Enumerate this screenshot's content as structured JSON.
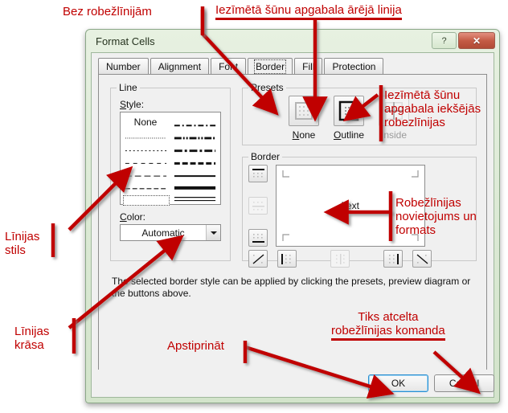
{
  "window": {
    "title": "Format Cells",
    "help_button": "?",
    "close_button": "✕"
  },
  "tabs": [
    {
      "label": "Number",
      "active": false
    },
    {
      "label": "Alignment",
      "active": false
    },
    {
      "label": "Font",
      "active": false
    },
    {
      "label": "Border",
      "active": true
    },
    {
      "label": "Fill",
      "active": false
    },
    {
      "label": "Protection",
      "active": false
    }
  ],
  "line_group": {
    "legend": "Line",
    "style_label": "Style:",
    "none_label": "None",
    "color_label": "Color:",
    "color_value": "Automatic",
    "styles_left": [
      "none",
      "dotted-fine",
      "dotted",
      "dashed-wide",
      "dash-long",
      "dashed-med",
      "hairline-selected"
    ],
    "styles_right": [
      "dash-dot-large",
      "dash-dot-dot-bold",
      "dash-dot-bold",
      "dash-med-bold",
      "solid-thin",
      "solid-thick",
      "double"
    ]
  },
  "presets_group": {
    "legend": "Presets",
    "items": [
      {
        "caption": "None",
        "enabled": true
      },
      {
        "caption": "Outline",
        "enabled": true
      },
      {
        "caption": "Inside",
        "enabled": false
      }
    ]
  },
  "border_group": {
    "legend": "Border",
    "preview_text": "Text",
    "left_buttons": [
      {
        "name": "top-border-button",
        "enabled": true
      },
      {
        "name": "horizontal-inside-border-button",
        "enabled": false
      },
      {
        "name": "bottom-border-button",
        "enabled": true
      }
    ],
    "bottom_buttons": [
      {
        "name": "diagonal-up-border-button",
        "enabled": true
      },
      {
        "name": "left-border-button",
        "enabled": true
      },
      {
        "name": "vertical-inside-border-button",
        "enabled": false
      },
      {
        "name": "right-border-button",
        "enabled": true
      },
      {
        "name": "diagonal-down-border-button",
        "enabled": true
      }
    ]
  },
  "hint": "The selected border style can be applied by clicking the presets, preview diagram or the buttons above.",
  "buttons": {
    "ok": "OK",
    "cancel": "Cancel"
  },
  "annotations": {
    "no_borders": "Bez robežlīnijām",
    "outer_line": "Iezīmētā šūnu apgabala ārējā linija",
    "inner_lines": "Iezīmētā šūnu\napgabala iekšējās\nrobezlīnijas",
    "line_style": "Līnijas\nstils",
    "line_color": "Līnijas\nkrāsa",
    "placement_format": "Robežlīnijas\nnovietojums un\nformats",
    "confirm": "Apstiprināt",
    "cancel_command": "Tiks atcelta\nrobežlīnijas komanda"
  },
  "colors": {
    "annotation": "#c00000",
    "title_bar": "#dbe9d4",
    "close_button": "#c45a44",
    "focus_ring": "#2a8ed0"
  }
}
